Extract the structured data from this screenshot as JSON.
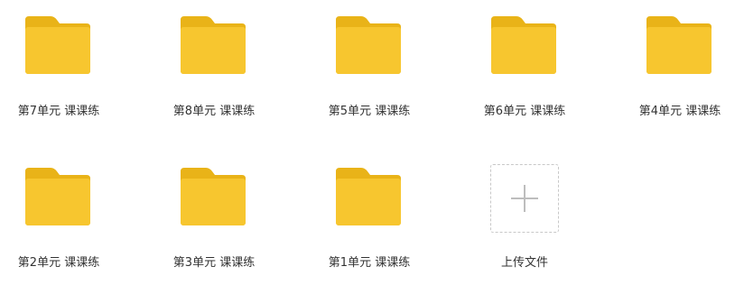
{
  "colors": {
    "folder_body": "#F7C62F",
    "folder_tab": "#E9B318",
    "text": "#333333",
    "upload_border": "#C8C8C8",
    "plus": "#BDBDBD"
  },
  "folders": [
    {
      "label": "第7单元 课课练",
      "icon": "folder-icon"
    },
    {
      "label": "第8单元 课课练",
      "icon": "folder-icon"
    },
    {
      "label": "第5单元 课课练",
      "icon": "folder-icon"
    },
    {
      "label": "第6单元 课课练",
      "icon": "folder-icon"
    },
    {
      "label": "第4单元 课课练",
      "icon": "folder-icon"
    },
    {
      "label": "第2单元 课课练",
      "icon": "folder-icon"
    },
    {
      "label": "第3单元 课课练",
      "icon": "folder-icon"
    },
    {
      "label": "第1单元 课课练",
      "icon": "folder-icon"
    }
  ],
  "upload": {
    "label": "上传文件",
    "icon": "plus-icon"
  }
}
